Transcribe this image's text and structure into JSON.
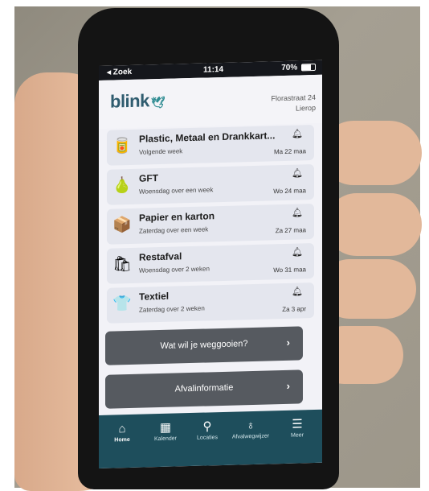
{
  "status_bar": {
    "carrier": "◂ Zoek",
    "time": "11:14",
    "battery": "70%"
  },
  "header": {
    "logo": "blink",
    "address_line1": "Florastraat 24",
    "address_line2": "Lierop"
  },
  "waste_items": [
    {
      "icon": "plastic-metal-icon",
      "glyph": "🥫",
      "title": "Plastic, Metaal en Drankkart...",
      "subtitle": "Volgende week",
      "date": "Ma 22 maa"
    },
    {
      "icon": "gft-icon",
      "glyph": "🍐",
      "title": "GFT",
      "subtitle": "Woensdag over een week",
      "date": "Wo 24 maa"
    },
    {
      "icon": "paper-box-icon",
      "glyph": "📦",
      "title": "Papier en karton",
      "subtitle": "Zaterdag over een week",
      "date": "Za 27 maa"
    },
    {
      "icon": "trash-bag-icon",
      "glyph": "🛍",
      "title": "Restafval",
      "subtitle": "Woensdag over 2 weken",
      "date": "Wo 31 maa"
    },
    {
      "icon": "textile-icon",
      "glyph": "👕",
      "title": "Textiel",
      "subtitle": "Zaterdag over 2 weken",
      "date": "Za 3 apr"
    }
  ],
  "buttons": {
    "dispose_label": "Wat wil je weggooien?",
    "info_label": "Afvalinformatie"
  },
  "tabs": [
    {
      "label": "Home",
      "icon": "home-icon",
      "glyph": "⌂"
    },
    {
      "label": "Kalender",
      "icon": "calendar-icon",
      "glyph": "▦"
    },
    {
      "label": "Locaties",
      "icon": "location-pin-icon",
      "glyph": "⚲"
    },
    {
      "label": "Afvalwegwijzer",
      "icon": "lightbulb-icon",
      "glyph": "♁"
    },
    {
      "label": "Meer",
      "icon": "list-menu-icon",
      "glyph": "☰"
    }
  ],
  "colors": {
    "brand": "#2f5c6f",
    "tabbar": "#1e4e5c",
    "button": "#565a60"
  }
}
